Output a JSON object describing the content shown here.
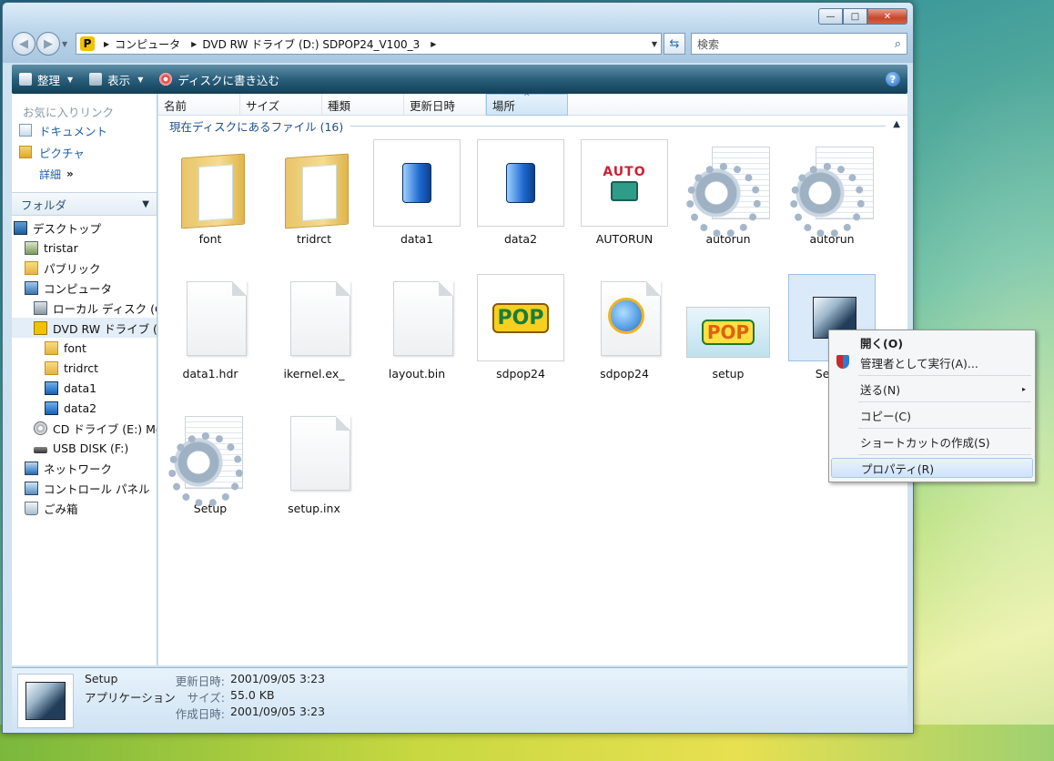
{
  "window": {
    "caption_buttons": {
      "minimize": "—",
      "maximize": "□",
      "close": "✕"
    },
    "address": {
      "crumbs": [
        "コンピュータ",
        "DVD RW ドライブ (D:) SDPOP24_V100_3"
      ],
      "location_icon_letter": "P"
    },
    "search_placeholder": "検索"
  },
  "toolbar": {
    "organize": "整理",
    "views": "表示",
    "burn": "ディスクに書き込む",
    "help": "?"
  },
  "left_pane": {
    "favorites_header": "お気に入りリンク",
    "favorites": [
      {
        "label": "ドキュメント",
        "icon": "documents-icon"
      },
      {
        "label": "ピクチャ",
        "icon": "pictures-icon"
      }
    ],
    "details_link": "詳細",
    "details_chevron": "»",
    "folders_header": "フォルダ",
    "folders_chevron": "⌄",
    "tree": [
      {
        "label": "デスクトップ",
        "indent": 0,
        "icon": "desktop-icon"
      },
      {
        "label": "tristar",
        "indent": 1,
        "icon": "user-folder-icon"
      },
      {
        "label": "パブリック",
        "indent": 1,
        "icon": "folder-icon"
      },
      {
        "label": "コンピュータ",
        "indent": 1,
        "icon": "computer-icon"
      },
      {
        "label": "ローカル ディスク (C",
        "indent": 2,
        "icon": "harddisk-icon"
      },
      {
        "label": "DVD RW ドライブ (I",
        "indent": 2,
        "icon": "dvd-drive-icon",
        "selected": true
      },
      {
        "label": "font",
        "indent": 3,
        "icon": "folder-icon"
      },
      {
        "label": "tridrct",
        "indent": 3,
        "icon": "folder-icon"
      },
      {
        "label": "data1",
        "indent": 3,
        "icon": "cabinet-icon"
      },
      {
        "label": "data2",
        "indent": 3,
        "icon": "cabinet-icon"
      },
      {
        "label": "CD ドライブ (E:) Me",
        "indent": 2,
        "icon": "cd-drive-icon"
      },
      {
        "label": "USB DISK (F:)",
        "indent": 2,
        "icon": "usb-drive-icon"
      },
      {
        "label": "ネットワーク",
        "indent": 1,
        "icon": "network-icon"
      },
      {
        "label": "コントロール パネル",
        "indent": 1,
        "icon": "control-panel-icon"
      },
      {
        "label": "ごみ箱",
        "indent": 1,
        "icon": "recycle-bin-icon"
      }
    ]
  },
  "columns": [
    "名前",
    "サイズ",
    "種類",
    "更新日時",
    "場所"
  ],
  "group_header": "現在ディスクにあるファイル (16)",
  "files": [
    {
      "label": "font",
      "kind": "folder"
    },
    {
      "label": "tridrct",
      "kind": "folder"
    },
    {
      "label": "data1",
      "kind": "cabinet"
    },
    {
      "label": "data2",
      "kind": "cabinet"
    },
    {
      "label": "AUTORUN",
      "kind": "autorun"
    },
    {
      "label": "autorun",
      "kind": "config"
    },
    {
      "label": "autorun",
      "kind": "config"
    },
    {
      "label": "data1.hdr",
      "kind": "blank"
    },
    {
      "label": "ikernel.ex_",
      "kind": "blank"
    },
    {
      "label": "layout.bin",
      "kind": "blank"
    },
    {
      "label": "sdpop24",
      "kind": "pop-icon"
    },
    {
      "label": "sdpop24",
      "kind": "ie-icon"
    },
    {
      "label": "setup",
      "kind": "pop-banner"
    },
    {
      "label": "Setup",
      "kind": "setup-app",
      "selected": true
    },
    {
      "label": "Setup",
      "kind": "config"
    },
    {
      "label": "setup.inx",
      "kind": "blank"
    }
  ],
  "context_menu": {
    "items": [
      {
        "label": "開く(O)",
        "bold": true
      },
      {
        "label": "管理者として実行(A)...",
        "shield": true
      },
      {
        "sep": true
      },
      {
        "label": "送る(N)",
        "submenu": true
      },
      {
        "sep": true
      },
      {
        "label": "コピー(C)"
      },
      {
        "sep": true
      },
      {
        "label": "ショートカットの作成(S)"
      },
      {
        "sep": true
      },
      {
        "label": "プロパティ(R)",
        "selected": true
      }
    ],
    "submenu_arrow": "▸"
  },
  "status": {
    "name": "Setup",
    "type": "アプリケーション",
    "modified_label": "更新日時:",
    "modified_value": "2001/09/05 3:23",
    "size_label": "サイズ:",
    "size_value": "55.0 KB",
    "created_label": "作成日時:",
    "created_value": "2001/09/05 3:23"
  },
  "pop_logo_text": "POP",
  "autorun_logo_text": "AUTO"
}
